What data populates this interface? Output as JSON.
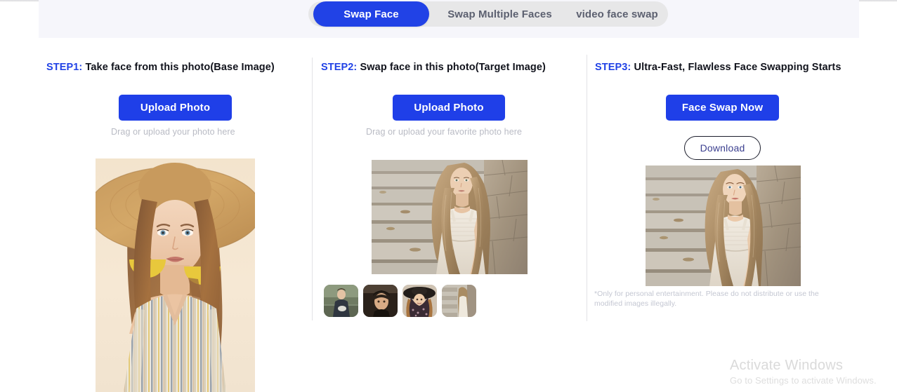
{
  "tabs": [
    {
      "label": "Swap Face",
      "active": true
    },
    {
      "label": "Swap Multiple Faces",
      "active": false
    },
    {
      "label": "video face swap",
      "active": false
    }
  ],
  "colors": {
    "accent": "#1f3fe8",
    "tab_active_bg": "#2142e6",
    "tab_bar_bg": "#e7e7e8",
    "panel_bg": "#f6f6fb",
    "step_label": "#2142e6",
    "hint_text": "#b9bbc4",
    "disclaimer_text": "#c4c7d2",
    "divider": "#e2e2e6",
    "download_border": "#1b1d2b",
    "download_text": "#3b3f8f",
    "watermark": "#dadada"
  },
  "step1": {
    "num": "STEP1:",
    "title": " Take face from this photo(Base Image)",
    "upload_label": "Upload Photo",
    "hint": "Drag or upload your photo here",
    "image_alt": "woman-in-straw-hat-with-yellow-earrings"
  },
  "step2": {
    "num": "STEP2:",
    "title": " Swap face in this photo(Target Image)",
    "upload_label": "Upload Photo",
    "hint": "Drag or upload your favorite photo here",
    "image_alt": "woman-leaning-on-stone-wall-by-stairs",
    "thumbnails": [
      {
        "alt": "man-sitting-outdoors-thumbnail"
      },
      {
        "alt": "woman-in-dark-hat-thumbnail"
      },
      {
        "alt": "woman-in-black-wide-brim-hat-thumbnail"
      },
      {
        "alt": "woman-by-stone-wall-thumbnail"
      }
    ]
  },
  "step3": {
    "num": "STEP3:",
    "title": " Ultra-Fast, Flawless Face Swapping Starts",
    "swap_label": "Face Swap Now",
    "download_label": "Download",
    "image_alt": "face-swapped-result-woman-by-stone-wall",
    "disclaimer": "*Only for personal entertainment. Please do not distribute or use the modified images illegally."
  },
  "watermark": {
    "title": "Activate Windows",
    "subtitle": "Go to Settings to activate Windows."
  }
}
